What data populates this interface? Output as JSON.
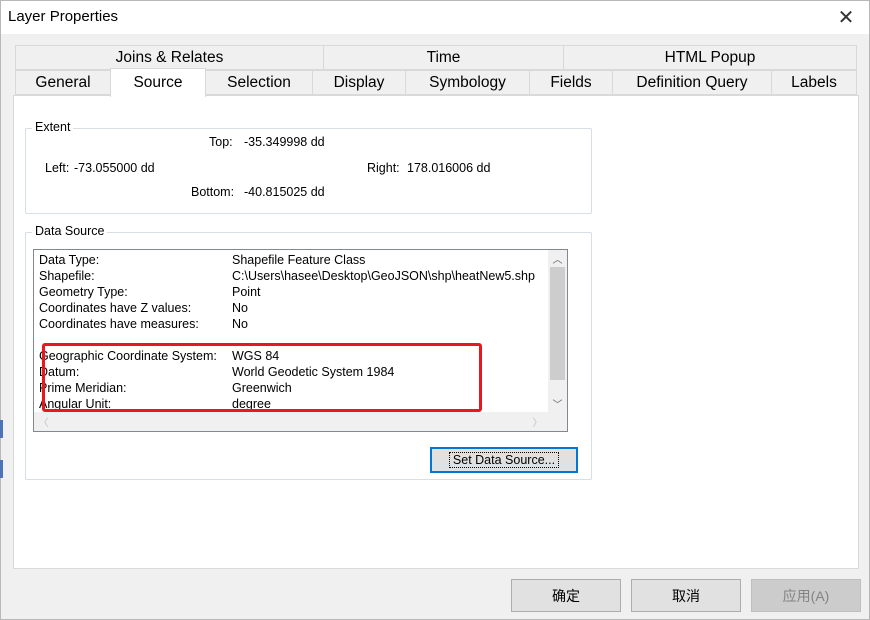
{
  "window": {
    "title": "Layer Properties",
    "close_glyph": "✕"
  },
  "tabs": {
    "row1": [
      {
        "label": "Joins & Relates"
      },
      {
        "label": "Time"
      },
      {
        "label": "HTML Popup"
      }
    ],
    "row2": [
      {
        "label": "General"
      },
      {
        "label": "Source",
        "active": true
      },
      {
        "label": "Selection"
      },
      {
        "label": "Display"
      },
      {
        "label": "Symbology"
      },
      {
        "label": "Fields"
      },
      {
        "label": "Definition Query"
      },
      {
        "label": "Labels"
      }
    ]
  },
  "extent": {
    "legend": "Extent",
    "top_label": "Top:",
    "top_value": "-35.349998 dd",
    "left_label": "Left:",
    "left_value": "-73.055000 dd",
    "right_label": "Right:",
    "right_value": "178.016006 dd",
    "bottom_label": "Bottom:",
    "bottom_value": "-40.815025 dd"
  },
  "data_source": {
    "legend": "Data Source",
    "rows": [
      {
        "key": "Data Type:",
        "value": "Shapefile Feature Class"
      },
      {
        "key": "Shapefile:",
        "value": "C:\\Users\\hasee\\Desktop\\GeoJSON\\shp\\heatNew5.shp"
      },
      {
        "key": "Geometry Type:",
        "value": "Point"
      },
      {
        "key": "Coordinates have Z values:",
        "value": "No"
      },
      {
        "key": "Coordinates have measures:",
        "value": "No"
      },
      {
        "key": "Geographic Coordinate System:",
        "value": "WGS 84"
      },
      {
        "key": "Datum:",
        "value": "World Geodetic System 1984"
      },
      {
        "key": "Prime Meridian:",
        "value": "Greenwich"
      },
      {
        "key": "Angular Unit:",
        "value": "degree"
      }
    ],
    "set_button": "Set Data Source..."
  },
  "buttons": {
    "ok": "确定",
    "cancel": "取消",
    "apply": "应用(A)"
  },
  "colors": {
    "highlight": "#e8181e",
    "focus": "#0078d7"
  }
}
